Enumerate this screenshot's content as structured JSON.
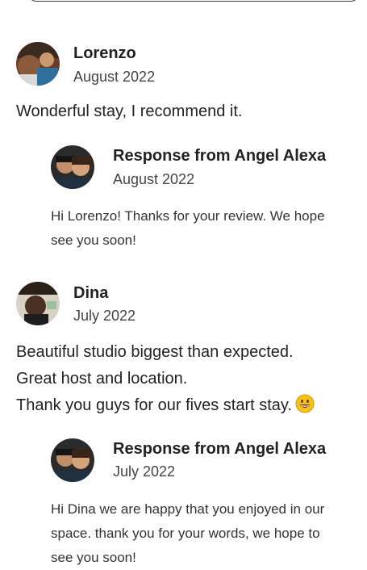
{
  "reviews": [
    {
      "name": "Lorenzo",
      "date": "August 2022",
      "text_lines": [
        "Wonderful stay, I recommend it."
      ],
      "response": {
        "title": "Response from Angel Alexa",
        "date": "August 2022",
        "text_lines": [
          "Hi Lorenzo! Thanks for your review. We hope",
          "see you soon!"
        ]
      }
    },
    {
      "name": "Dina",
      "date": "July 2022",
      "text_lines": [
        "Beautiful studio biggest than expected.",
        "Great host and location.",
        "Thank you guys for our fives start stay."
      ],
      "emoji": "grinning-face-emoji",
      "response": {
        "title": "Response from Angel Alexa",
        "date": "July 2022",
        "text_lines": [
          "Hi Dina we are happy that you enjoyed in our",
          "space. thank you for your words, we hope to",
          "see you soon!"
        ]
      }
    }
  ],
  "colors": {
    "text_primary": "#222222",
    "text_secondary": "#444444",
    "background": "#ffffff",
    "emoji_yellow": "#f5c21b"
  }
}
